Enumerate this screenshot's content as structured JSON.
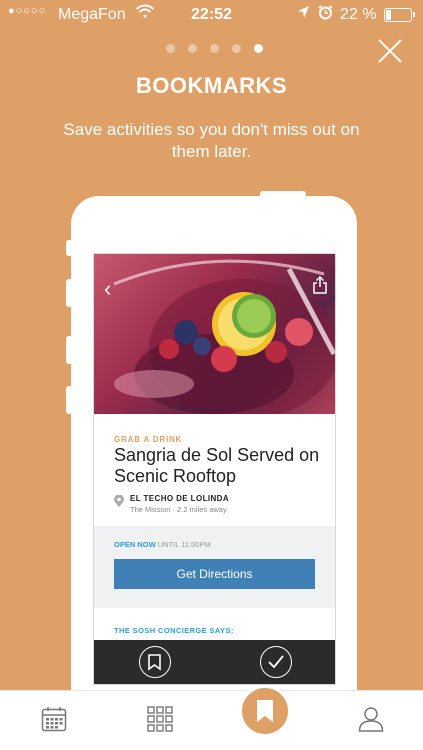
{
  "status_bar": {
    "signal_dots": "●○○○○",
    "carrier": "MegaFon",
    "time": "22:52",
    "battery_percent": "22 %",
    "battery_level": 0.22,
    "icons": [
      "wifi-icon",
      "location-arrow-icon",
      "alarm-icon",
      "battery-icon"
    ]
  },
  "pager": {
    "total": 5,
    "active_index": 4
  },
  "header": {
    "title": "BOOKMARKS",
    "subtitle": "Save activities so you don't miss out on them later."
  },
  "card": {
    "category": "GRAB A DRINK",
    "title": "Sangria de Sol Served on Scenic Rooftop",
    "venue": "EL TECHO DE LOLINDA",
    "neighborhood": "The Mission",
    "distance": "· 2.2 miles away",
    "open_status": "OPEN NOW",
    "open_until": "UNTIL 11:00PM",
    "directions_label": "Get Directions",
    "concierge_label": "THE SOSH CONCIERGE SAYS:"
  },
  "tabs": [
    {
      "icon": "calendar-icon",
      "active": false
    },
    {
      "icon": "grid-icon",
      "active": false
    },
    {
      "icon": "bookmark-icon",
      "active": true
    },
    {
      "icon": "profile-icon",
      "active": false
    }
  ],
  "colors": {
    "background": "#dfa068",
    "accent_blue": "#3f81b6",
    "open_now_blue": "#2a9fd6",
    "dark_bar": "#2b2b2b"
  }
}
